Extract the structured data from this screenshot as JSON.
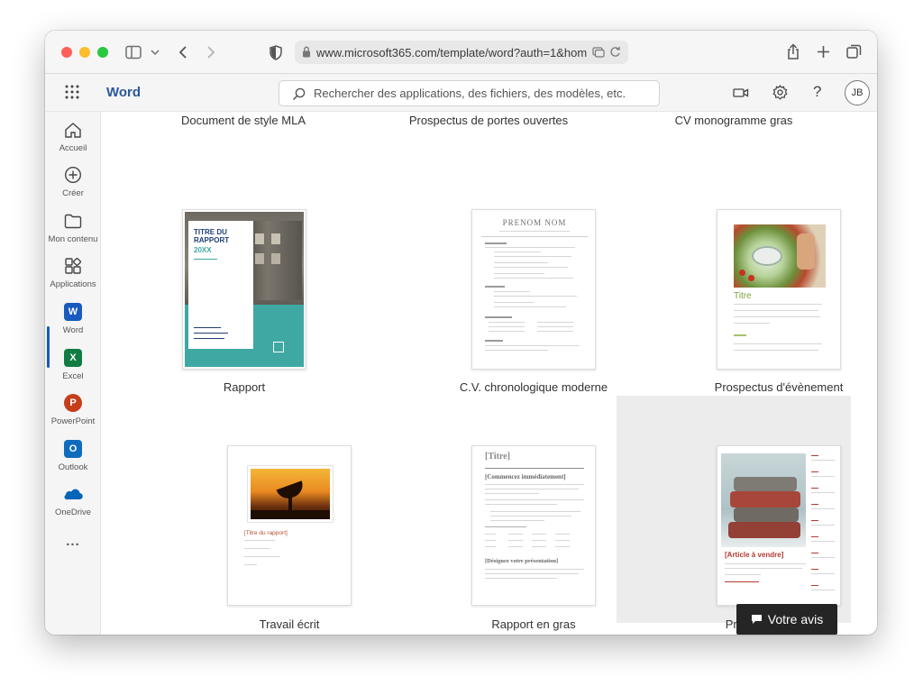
{
  "browser": {
    "url": "www.microsoft365.com/template/word?auth=1&hom"
  },
  "app": {
    "name": "Word",
    "search_placeholder": "Rechercher des applications, des fichiers, des modèles, etc.",
    "user_initials": "JB"
  },
  "rail": {
    "items": [
      {
        "label": "Accueil",
        "icon": "home-icon"
      },
      {
        "label": "Créer",
        "icon": "plus-circle-icon"
      },
      {
        "label": "Mon contenu",
        "icon": "folder-icon"
      },
      {
        "label": "Applications",
        "icon": "apps-icon"
      },
      {
        "label": "Word",
        "icon": "word-logo",
        "active": true
      },
      {
        "label": "Excel",
        "icon": "excel-logo"
      },
      {
        "label": "PowerPoint",
        "icon": "powerpoint-logo"
      },
      {
        "label": "Outlook",
        "icon": "outlook-logo"
      },
      {
        "label": "OneDrive",
        "icon": "onedrive-logo"
      }
    ],
    "more": "..."
  },
  "templates": {
    "top_row": [
      "Document de style MLA",
      "Prospectus de portes ouvertes",
      "CV monogramme gras"
    ],
    "cards": [
      {
        "label": "Rapport",
        "title": "TITRE DU RAPPORT",
        "year": "20XX"
      },
      {
        "label": "C.V. chronologique moderne",
        "title": "PRENOM NOM"
      },
      {
        "label": "Prospectus d'évènement",
        "title": "Titre"
      },
      {
        "label": "Travail écrit",
        "title": "[Titre du rapport]"
      },
      {
        "label": "Rapport en gras",
        "title": "[Titre]",
        "heading": "[Commencez immédiatement]",
        "heading2": "[Désignez votre présentation]"
      },
      {
        "label": "Prospectus de vente",
        "title": "[Article à vendre]"
      }
    ]
  },
  "feedback_label": "Votre avis",
  "colors": {
    "word_blue": "#185abd",
    "excel_green": "#107c41",
    "powerpoint_orange": "#c43e1c",
    "outlook_blue": "#0f6cbd",
    "onedrive_blue": "#0364b8",
    "report_teal": "#3fa8a3",
    "report_navy": "#1f3f73",
    "sale_red": "#b33a2f"
  }
}
